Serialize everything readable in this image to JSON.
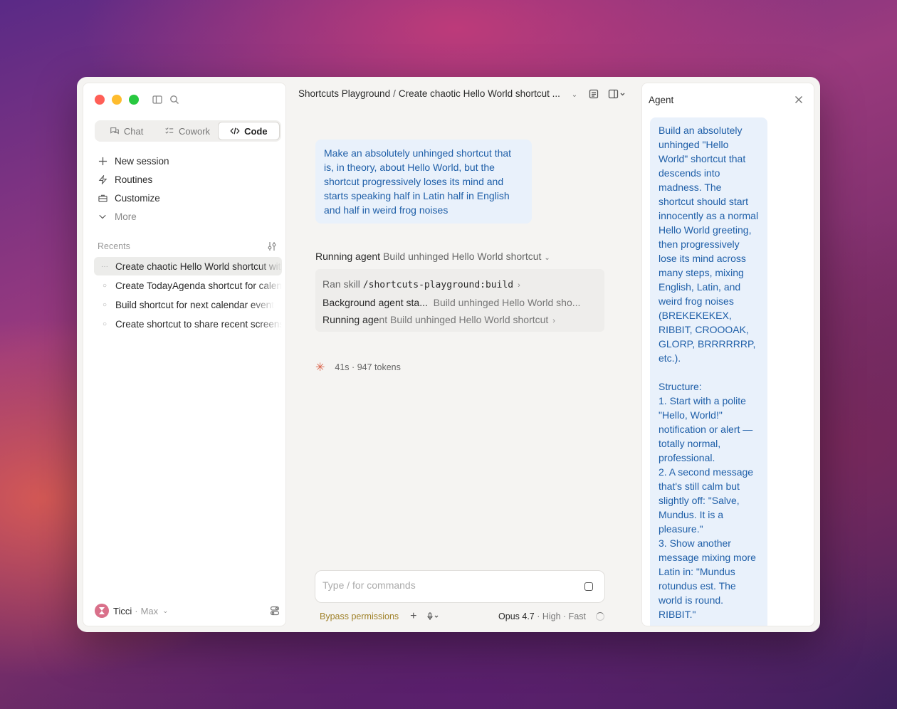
{
  "sidebar": {
    "tabs": [
      {
        "label": "Chat"
      },
      {
        "label": "Cowork"
      },
      {
        "label": "Code"
      }
    ],
    "menu": [
      {
        "label": "New session",
        "icon": "plus-icon"
      },
      {
        "label": "Routines",
        "icon": "bolt-icon"
      },
      {
        "label": "Customize",
        "icon": "briefcase-icon"
      },
      {
        "label": "More",
        "icon": "chevron-down-icon"
      }
    ],
    "recents_label": "Recents",
    "recents": [
      {
        "label": "Create chaotic Hello World shortcut with",
        "active": true
      },
      {
        "label": "Create TodayAgenda shortcut for calendar"
      },
      {
        "label": "Build shortcut for next calendar event"
      },
      {
        "label": "Create shortcut to share recent screenshot"
      }
    ],
    "user": {
      "name": "Ticci",
      "plan": "Max"
    }
  },
  "main": {
    "breadcrumb": {
      "project": "Shortcuts Playground",
      "sep": "/",
      "session": "Create chaotic Hello World shortcut ..."
    },
    "user_message": "Make an absolutely unhinged shortcut that is, in theory, about Hello World, but the shortcut progressively loses its mind and starts speaking half in Latin half in English and half in weird frog noises",
    "running": {
      "label": "Running agent",
      "desc": "Build unhinged Hello World shortcut"
    },
    "steps": {
      "skill_prefix": "Ran skill",
      "skill_name": "/shortcuts-playground:build",
      "bg_label": "Background agent sta...",
      "bg_desc": "Build unhinged Hello World sho...",
      "run_label_a": "Running age",
      "run_label_b": "nt",
      "run_desc": "Build unhinged Hello World shortcut"
    },
    "stats": {
      "time": "41s",
      "sep": "·",
      "tokens": "947 tokens"
    },
    "composer": {
      "placeholder": "Type / for commands"
    },
    "footer": {
      "bypass": "Bypass permissions",
      "model": "Opus 4.7",
      "mode": "· High · Fast"
    }
  },
  "agent": {
    "title": "Agent",
    "message": "Build an absolutely unhinged \"Hello World\" shortcut that descends into madness. The shortcut should start innocently as a normal Hello World greeting, then progressively lose its mind across many steps, mixing English, Latin, and weird frog noises (BREKEKEKEX, RIBBIT, CROOOAK, GLORP, BRRRRRRP, etc.).\n\nStructure:\n1. Start with a polite \"Hello, World!\" notification or alert — totally normal, professional.\n2. A second message that's still calm but slightly off: \"Salve, Mundus. It is a pleasure.\"\n3. Show another message mixing more Latin in: \"Mundus rotundus est. The world is round. RIBBIT.\""
  },
  "colors": {
    "accent_blue": "#1f5fa8",
    "bubble_bg": "#e9f1fb",
    "bypass": "#a0822a",
    "spark": "#d9624a"
  }
}
